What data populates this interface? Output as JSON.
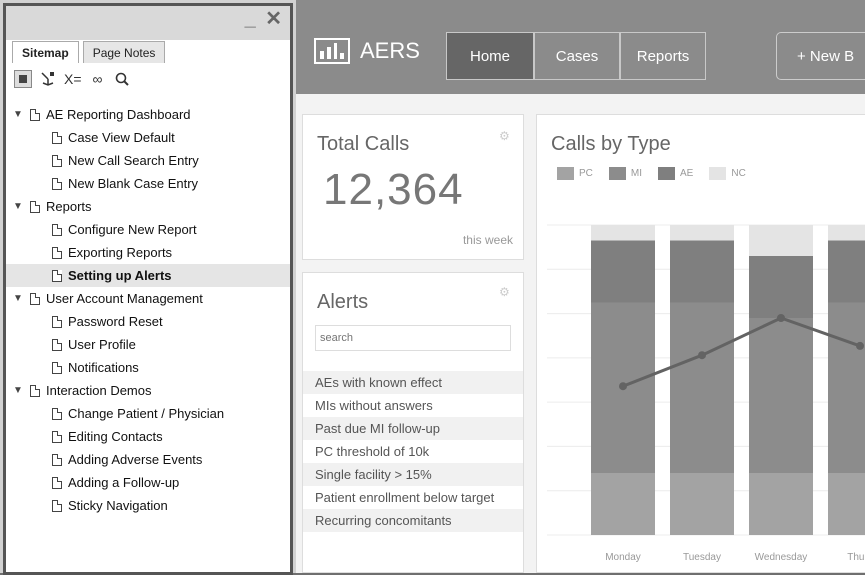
{
  "sitemap": {
    "tabs": [
      {
        "label": "Sitemap",
        "active": true
      },
      {
        "label": "Page Notes",
        "active": false
      }
    ],
    "window_controls": "_ ✕",
    "toolbar_icons": [
      "page-view-icon",
      "add-page-icon",
      "variable-icon",
      "link-icon",
      "search-icon"
    ],
    "toolbar_text": {
      "variable": "X=",
      "link": "∞"
    },
    "tree": [
      {
        "label": "AE Reporting Dashboard",
        "level": 0,
        "expanded": true
      },
      {
        "label": "Case View Default",
        "level": 1
      },
      {
        "label": "New Call Search Entry",
        "level": 1
      },
      {
        "label": "New Blank Case Entry",
        "level": 1
      },
      {
        "label": "Reports",
        "level": 0,
        "expanded": true
      },
      {
        "label": "Configure New Report",
        "level": 1
      },
      {
        "label": "Exporting Reports",
        "level": 1
      },
      {
        "label": "Setting up Alerts",
        "level": 1,
        "selected": true
      },
      {
        "label": "User Account Management",
        "level": 0,
        "expanded": true
      },
      {
        "label": "Password Reset",
        "level": 1
      },
      {
        "label": "User Profile",
        "level": 1
      },
      {
        "label": "Notifications",
        "level": 1
      },
      {
        "label": "Interaction Demos",
        "level": 0,
        "expanded": true
      },
      {
        "label": "Change Patient / Physician",
        "level": 1
      },
      {
        "label": "Editing Contacts",
        "level": 1
      },
      {
        "label": "Adding Adverse Events",
        "level": 1
      },
      {
        "label": "Adding a Follow-up",
        "level": 1
      },
      {
        "label": "Sticky Navigation",
        "level": 1
      }
    ]
  },
  "app": {
    "name": "AERS",
    "nav": [
      {
        "label": "Home",
        "active": true
      },
      {
        "label": "Cases",
        "active": false
      },
      {
        "label": "Reports",
        "active": false
      }
    ],
    "new_button_label": "+ New B"
  },
  "total_calls": {
    "title": "Total Calls",
    "value": "12,364",
    "period": "this week"
  },
  "alerts": {
    "title": "Alerts",
    "search_placeholder": "search",
    "items": [
      "AEs with known effect",
      "MIs without answers",
      "Past due MI follow-up",
      "PC threshold of 10k",
      "Single facility > 15%",
      "Patient enrollment below target",
      "Recurring concomitants"
    ]
  },
  "chart_data": {
    "type": "bar",
    "title": "Calls by Type",
    "stacked": true,
    "categories": [
      "Monday",
      "Tuesday",
      "Wednesday",
      "Thurs"
    ],
    "series": [
      {
        "name": "PC",
        "color": "#a3a3a3",
        "values": [
          20,
          20,
          20,
          20
        ]
      },
      {
        "name": "MI",
        "color": "#8c8c8c",
        "values": [
          55,
          55,
          50,
          55
        ]
      },
      {
        "name": "AE",
        "color": "#7f7f7f",
        "values": [
          20,
          20,
          20,
          20
        ]
      },
      {
        "name": "NC",
        "color": "#e4e4e4",
        "values": [
          5,
          5,
          10,
          5
        ]
      }
    ],
    "line_series": {
      "color": "#636363",
      "values": [
        0.48,
        0.58,
        0.7,
        0.61
      ]
    },
    "gridlines": true,
    "legend_position": "top-left"
  }
}
